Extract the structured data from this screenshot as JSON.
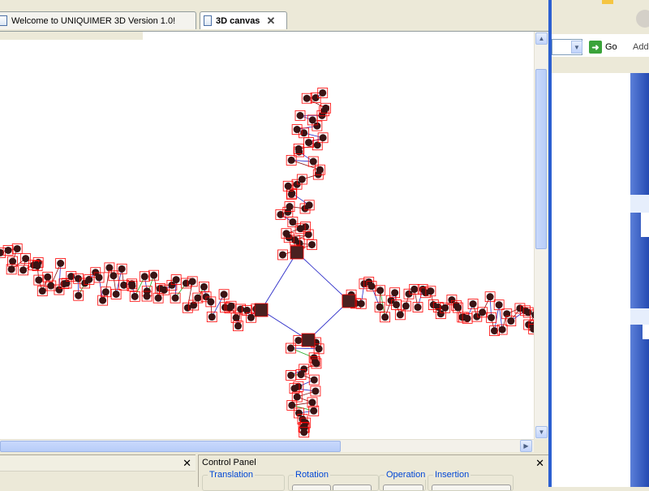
{
  "tabs": [
    {
      "label": "Welcome to UNIQUIMER 3D Version 1.0!",
      "active": false
    },
    {
      "label": "3D canvas",
      "active": true
    }
  ],
  "close_glyph": "✕",
  "control_panel": {
    "title": "Control Panel",
    "groups": [
      "Translation",
      "Rotation",
      "Operation",
      "Insertion"
    ]
  },
  "browser": {
    "go_label": "Go",
    "address_label_partial": "Add"
  },
  "icons": {
    "tab_page": "document-icon",
    "go": "go-arrow-icon",
    "dropdown": "chevron-down-icon"
  },
  "colors": {
    "node_fill": "#3a1414",
    "node_box": "#ff0000",
    "link_blue": "#2c2cc8",
    "link_green": "#22aa22",
    "xp_blue": "#2b5fd1"
  }
}
